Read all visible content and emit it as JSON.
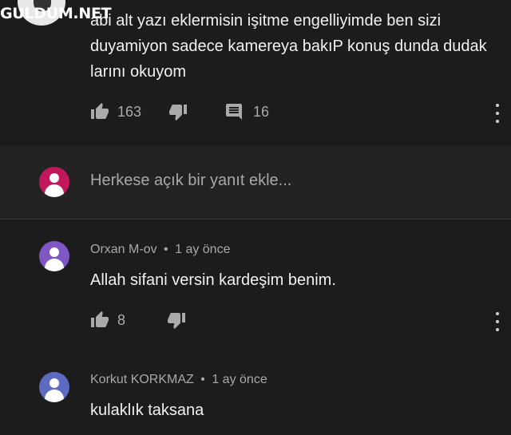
{
  "watermark": {
    "text": "GULDUM.NET"
  },
  "top_comment": {
    "text": "abi alt yazı eklermisin işitme engelliyimde ben sizi duyamiyon sadece kamereya bakıP konuş dunda dudak larını okuyom",
    "likes": "163",
    "replies": "16"
  },
  "reply_box": {
    "placeholder": "Herkese açık bir yanıt ekle...",
    "avatar_color": "#c2185b"
  },
  "replies": [
    {
      "author": "Orxan M-ov",
      "time": "1 ay önce",
      "text": "Allah sifani versin kardeşim benim.",
      "likes": "8",
      "avatar_color": "#7e57c2"
    },
    {
      "author": "Korkut KORKMAZ",
      "time": "1 ay önce",
      "text": "kulaklık taksana",
      "avatar_color": "#5c6bc0"
    }
  ],
  "icons": {
    "like": "thumbs-up-icon",
    "dislike": "thumbs-down-icon",
    "reply": "comment-icon",
    "more": "more-vert-icon"
  },
  "separator": "•"
}
